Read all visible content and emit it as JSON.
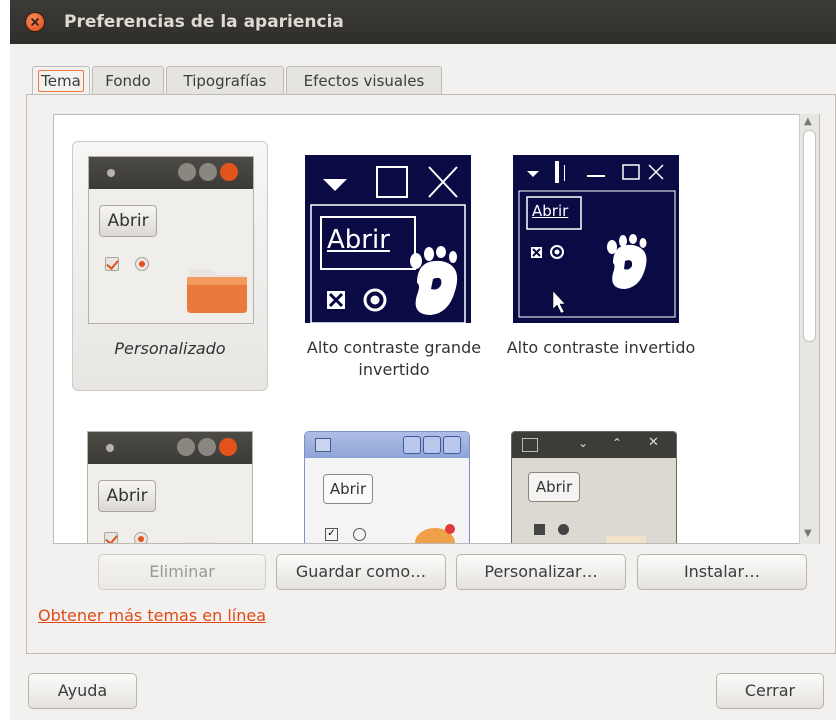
{
  "window": {
    "title": "Preferencias de la apariencia"
  },
  "tabs": [
    {
      "label": "Tema",
      "active": true
    },
    {
      "label": "Fondo"
    },
    {
      "label": "Tipografías"
    },
    {
      "label": "Efectos visuales"
    }
  ],
  "themes": [
    {
      "label": "Personalizado",
      "selected": true,
      "preview": {
        "button": "Abrir"
      }
    },
    {
      "label": "Alto contraste grande invertido",
      "preview": {
        "button": "Abrir"
      }
    },
    {
      "label": "Alto contraste invertido",
      "preview": {
        "button": "Abrir"
      }
    },
    {
      "label": "",
      "preview": {
        "button": "Abrir"
      }
    },
    {
      "label": "",
      "preview": {
        "button": "Abrir"
      }
    },
    {
      "label": "",
      "preview": {
        "button": "Abrir"
      }
    }
  ],
  "actions": {
    "delete": "Eliminar",
    "save_as": "Guardar como…",
    "customize": "Personalizar…",
    "install": "Instalar…"
  },
  "more_themes_link": "Obtener más temas en línea",
  "footer": {
    "help": "Ayuda",
    "close": "Cerrar"
  },
  "colors": {
    "accent": "#df4a16",
    "titlebar": "#3c3b37",
    "hc_background": "#0a0a45"
  }
}
